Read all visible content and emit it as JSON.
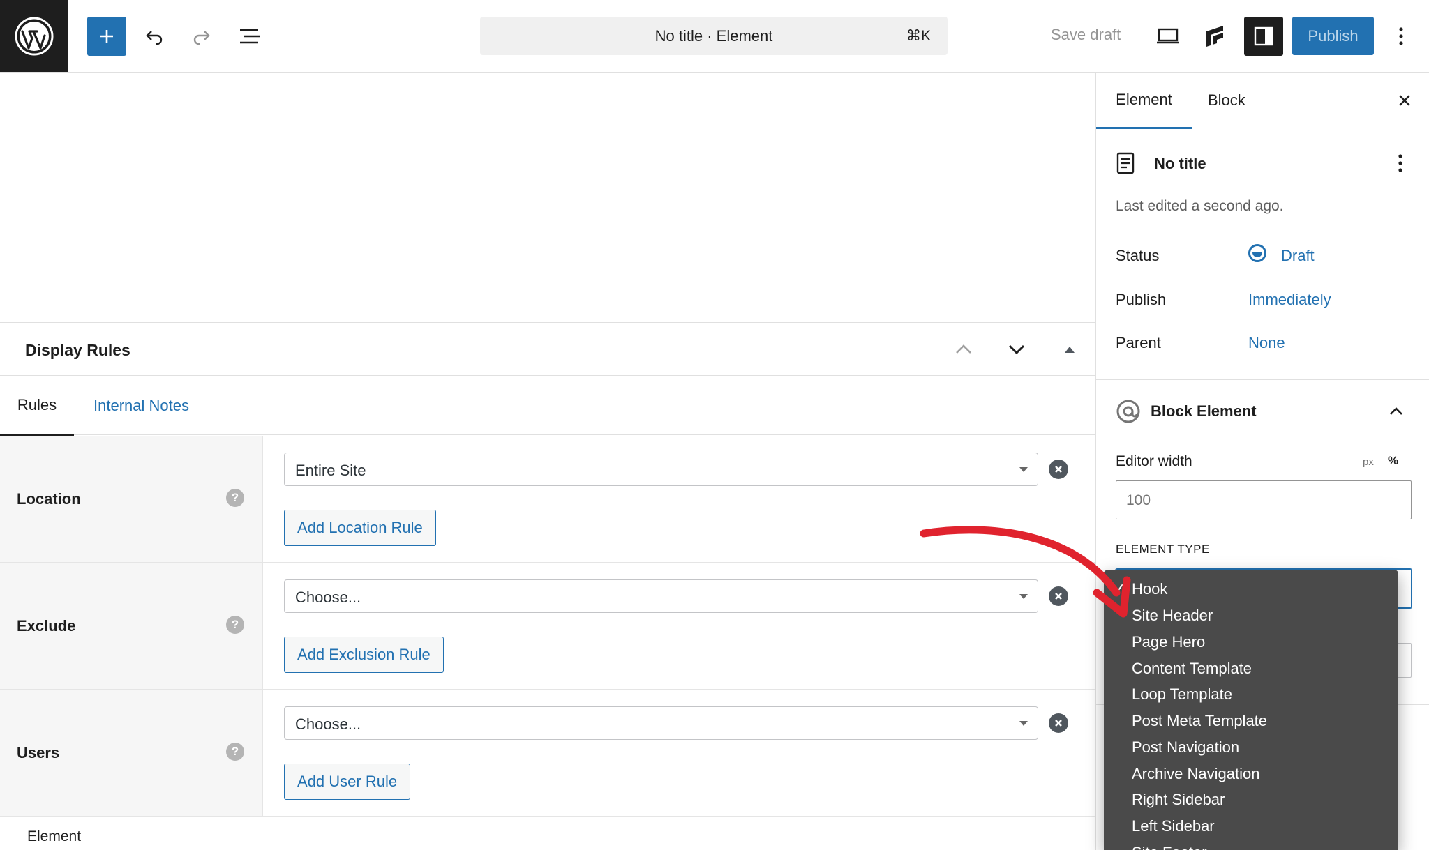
{
  "toolbar": {
    "add_label": "+",
    "command_title": "No title · Element",
    "command_shortcut": "⌘K",
    "save_draft": "Save draft",
    "publish": "Publish",
    "icons": [
      "wordpress-logo",
      "plus-icon",
      "undo-icon",
      "redo-icon",
      "list-view-icon",
      "desktop-view-icon",
      "generatepress-icon",
      "settings-sidebar-icon",
      "more-vertical-icon"
    ]
  },
  "display_rules": {
    "title": "Display Rules",
    "tabs": [
      "Rules",
      "Internal Notes"
    ],
    "rows": [
      {
        "label": "Location",
        "help": "?",
        "select_value": "Entire Site",
        "add_button": "Add Location Rule"
      },
      {
        "label": "Exclude",
        "help": "?",
        "select_value": "Choose...",
        "add_button": "Add Exclusion Rule"
      },
      {
        "label": "Users",
        "help": "?",
        "select_value": "Choose...",
        "add_button": "Add User Rule"
      }
    ]
  },
  "footer": {
    "breadcrumb": "Element"
  },
  "sidebar": {
    "tabs": [
      "Element",
      "Block"
    ],
    "doc_title": "No title",
    "last_edited": "Last edited a second ago.",
    "meta": [
      {
        "label": "Status",
        "value": "Draft"
      },
      {
        "label": "Publish",
        "value": "Immediately"
      },
      {
        "label": "Parent",
        "value": "None"
      }
    ],
    "block_element_title": "Block Element",
    "editor_width_label": "Editor width",
    "unit_px": "px",
    "unit_pct": "%",
    "editor_width_value": "100",
    "element_type_label": "ELEMENT TYPE"
  },
  "dropdown": {
    "selected_mark": "✓",
    "options": [
      "Hook",
      "Site Header",
      "Page Hero",
      "Content Template",
      "Loop Template",
      "Post Meta Template",
      "Post Navigation",
      "Archive Navigation",
      "Right Sidebar",
      "Left Sidebar",
      "Site Footer"
    ],
    "selected": "Hook"
  },
  "colors": {
    "accent": "#2271b1",
    "dark": "#1e1e1e",
    "annotation": "#e0232e",
    "dropdown_bg": "#4a4a4a"
  }
}
